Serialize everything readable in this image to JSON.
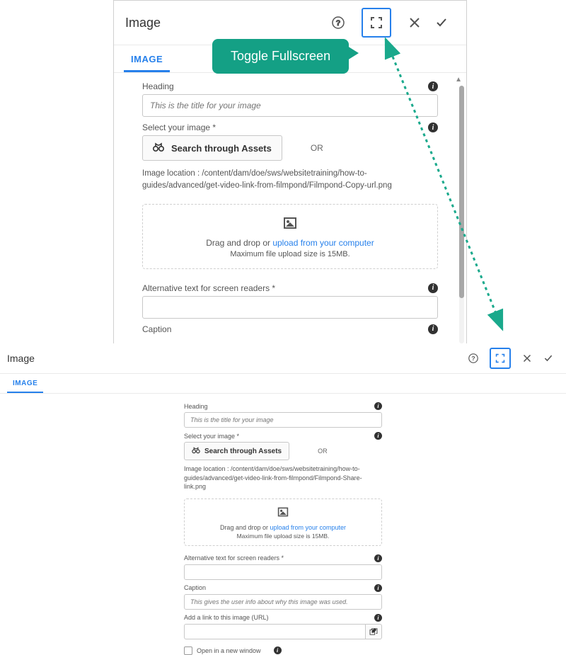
{
  "callout": {
    "text": "Toggle Fullscreen"
  },
  "dialog1": {
    "title": "Image",
    "tab": "IMAGE",
    "heading_label": "Heading",
    "heading_placeholder": "This is the title for your image",
    "select_label": "Select your image *",
    "search_assets": "Search through Assets",
    "or": "OR",
    "loc_prefix": "Image location : ",
    "loc_path": "/content/dam/doe/sws/websitetraining/how-to-guides/advanced/get-video-link-from-filmpond/Filmpond-Copy-url.png",
    "dz_text_pre": "Drag and drop or ",
    "dz_link": "upload from your computer",
    "dz_sub": "Maximum file upload size is 15MB.",
    "alt_label": "Alternative text for screen readers *",
    "caption_label": "Caption"
  },
  "dialog2": {
    "title": "Image",
    "tab": "IMAGE",
    "heading_label": "Heading",
    "heading_placeholder": "This is the title for your image",
    "select_label": "Select your image *",
    "search_assets": "Search through Assets",
    "or": "OR",
    "loc_prefix": "Image location : ",
    "loc_path": "/content/dam/doe/sws/websitetraining/how-to-guides/advanced/get-video-link-from-filmpond/Filmpond-Share-link.png",
    "dz_text_pre": "Drag and drop or ",
    "dz_link": "upload from your computer",
    "dz_sub": "Maximum file upload size is 15MB.",
    "alt_label": "Alternative text for screen readers *",
    "caption_label": "Caption",
    "caption_placeholder": "This gives the user info about why this image was used.",
    "link_label": "Add a link to this image (URL)",
    "newwin_label": "Open in a new window"
  }
}
